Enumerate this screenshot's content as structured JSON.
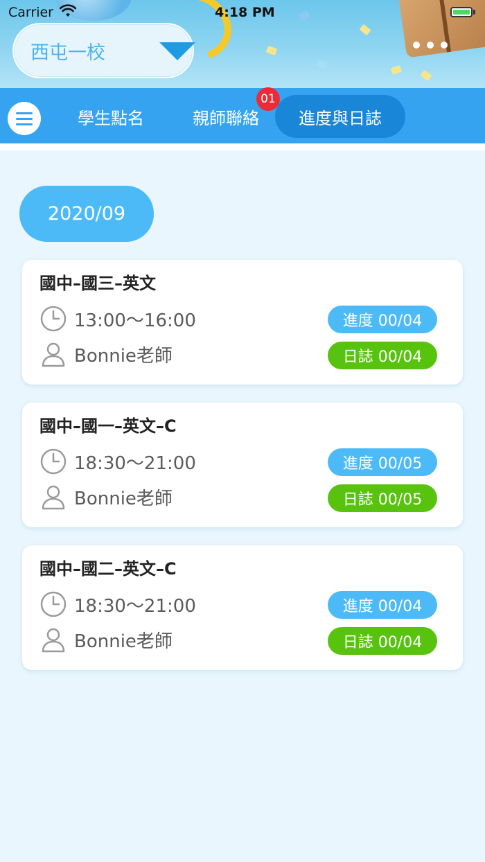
{
  "status_bar": {
    "carrier": "Carrier",
    "time": "4:18 PM"
  },
  "header": {
    "school": "西屯一校"
  },
  "tabs": {
    "roll_call": "學生點名",
    "contact": "親師聯絡",
    "contact_badge": "01",
    "progress": "進度與日誌",
    "active": "progress"
  },
  "month": "2020/09",
  "classes": [
    {
      "title": "國中–國三–英文",
      "time": "13:00～16:00",
      "teacher": "Bonnie老師",
      "progress": "進度 00/04",
      "log": "日誌 00/04"
    },
    {
      "title": "國中–國一–英文–C",
      "time": "18:30～21:00",
      "teacher": "Bonnie老師",
      "progress": "進度 00/05",
      "log": "日誌 00/05"
    },
    {
      "title": "國中–國二–英文–C",
      "time": "18:30～21:00",
      "teacher": "Bonnie老師",
      "progress": "進度 00/04",
      "log": "日誌 00/04"
    }
  ],
  "colors": {
    "tabbar": "#36a3f0",
    "active_tab": "#1a86d8",
    "progress_pill": "#4dbaf8",
    "log_pill": "#58c30f",
    "badge": "#ee2a37",
    "background": "#e9f6fd"
  }
}
